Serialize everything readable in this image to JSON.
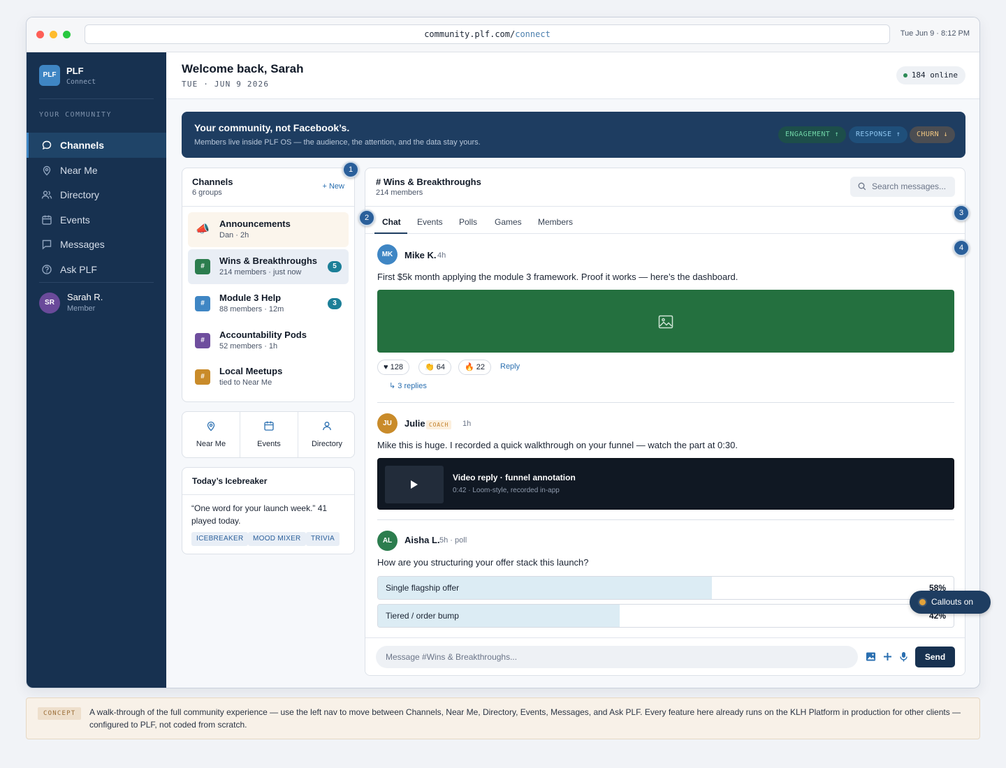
{
  "browser": {
    "url_host": "community.plf.com/",
    "url_path": "connect",
    "clock": "Tue Jun 9 · 8:12 PM"
  },
  "brand": {
    "logo": "PLF",
    "name": "PLF",
    "sub": "Connect"
  },
  "sidebar": {
    "section_label": "YOUR COMMUNITY",
    "items": [
      {
        "label": "Channels",
        "icon": "chat-bubble-icon",
        "active": true
      },
      {
        "label": "Near Me",
        "icon": "map-pin-icon"
      },
      {
        "label": "Directory",
        "icon": "users-icon"
      },
      {
        "label": "Events",
        "icon": "calendar-icon"
      },
      {
        "label": "Messages",
        "icon": "message-square-icon"
      },
      {
        "label": "Ask PLF",
        "icon": "help-circle-icon"
      }
    ],
    "user": {
      "initials": "SR",
      "name": "Sarah R.",
      "role": "Member"
    }
  },
  "header": {
    "welcome": "Welcome back, Sarah",
    "date": "TUE · JUN 9 2026",
    "online": "184 online"
  },
  "hero": {
    "title": "Your community, not Facebook’s.",
    "subtitle": "Members live inside PLF OS — the audience, the attention, and the data stay yours.",
    "chips": [
      "ENGAGEMENT ↑",
      "RESPONSE ↑",
      "CHURN ↓"
    ]
  },
  "channels": {
    "title": "Channels",
    "count": "6 groups",
    "new_label": "+ New",
    "items": [
      {
        "name": "Announcements",
        "meta": "Dan · 2h",
        "icon": "📣",
        "color": "#e9e2d6",
        "badge": ""
      },
      {
        "name": "Wins & Breakthroughs",
        "meta": "214 members · just now",
        "icon": "#",
        "color": "#2c7d4e",
        "badge": "5"
      },
      {
        "name": "Module 3 Help",
        "meta": "88 members · 12m",
        "icon": "#",
        "color": "#3f86c4",
        "badge": "3"
      },
      {
        "name": "Accountability Pods",
        "meta": "52 members · 1h",
        "icon": "#",
        "color": "#6f4e9e",
        "badge": ""
      },
      {
        "name": "Local Meetups",
        "meta": "tied to Near Me",
        "icon": "#",
        "color": "#c98b2a",
        "badge": ""
      }
    ]
  },
  "quick_links": [
    "Near Me",
    "Events",
    "Directory"
  ],
  "icebreaker": {
    "title": "Today’s Icebreaker",
    "text": "“One word for your launch week.” 41 played today.",
    "tags": [
      "ICEBREAKER",
      "MOOD MIXER",
      "TRIVIA"
    ]
  },
  "chat": {
    "channel": "# Wins & Breakthroughs",
    "members": "214 members",
    "search_placeholder": "Search messages...",
    "tabs": [
      "Chat",
      "Events",
      "Polls",
      "Games",
      "Members"
    ],
    "messages": [
      {
        "initials": "MK",
        "name": "Mike K.",
        "time": "4h",
        "text": "First $5k month applying the module 3 framework. Proof it works — here’s the dashboard.",
        "reactions": [
          "♥ 128",
          "👏 64",
          "🔥 22"
        ],
        "reply_label": "Reply",
        "thread_label": "↳ 3 replies"
      },
      {
        "initials": "JU",
        "name": "Julie",
        "role": "COACH",
        "time": "1h",
        "text": "Mike this is huge. I recorded a quick walkthrough on your funnel — watch the part at 0:30.",
        "video_title": "Video reply · funnel annotation",
        "video_sub": "0:42 · Loom-style, recorded in-app"
      },
      {
        "initials": "AL",
        "name": "Aisha L.",
        "time": "5h · poll",
        "text": "How are you structuring your offer stack this launch?",
        "poll": [
          {
            "label": "Single flagship offer",
            "pct_label": "58%",
            "pct": 58
          },
          {
            "label": "Tiered / order bump",
            "pct_label": "42%",
            "pct": 42
          }
        ]
      }
    ],
    "composer_placeholder": "Message #Wins & Breakthroughs...",
    "send_label": "Send"
  },
  "callouts": {
    "numbers": [
      "1",
      "2",
      "3",
      "4"
    ],
    "toggle_label": "Callouts on"
  },
  "concept": {
    "tag": "CONCEPT",
    "text": "A walk-through of the full community experience — use the left nav to move between Channels, Near Me, Directory, Events, Messages, and Ask PLF. Every feature here already runs on the KLH Platform in production for other clients — configured to PLF, not coded from scratch."
  },
  "colors": {
    "sidebar": "#173150",
    "hero": "#1e3d61",
    "accent": "#3f86c4",
    "image_block": "#24703f"
  }
}
